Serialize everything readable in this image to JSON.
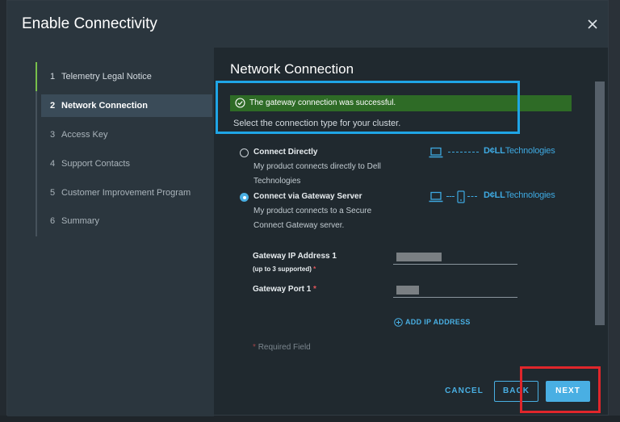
{
  "dialog": {
    "title": "Enable Connectivity"
  },
  "steps": [
    {
      "num": "1",
      "label": "Telemetry Legal Notice",
      "state": "complete"
    },
    {
      "num": "2",
      "label": "Network Connection",
      "state": "current"
    },
    {
      "num": "3",
      "label": "Access Key",
      "state": "pending"
    },
    {
      "num": "4",
      "label": "Support Contacts",
      "state": "pending"
    },
    {
      "num": "5",
      "label": "Customer Improvement Program",
      "state": "pending"
    },
    {
      "num": "6",
      "label": "Summary",
      "state": "pending"
    }
  ],
  "content": {
    "section_title": "Network Connection",
    "success_message": "The gateway connection was successful.",
    "select_prompt": "Select the connection type for your cluster.",
    "options": [
      {
        "label": "Connect Directly",
        "description": "My product connects directly to Dell Technologies",
        "selected": false,
        "diagram_icon": "laptop-icon"
      },
      {
        "label": "Connect via Gateway Server",
        "description": "My product connects to a Secure Connect Gateway server.",
        "selected": true,
        "diagram_icon": "gateway-server-icon"
      }
    ],
    "brand_bold": "D¢LL",
    "brand_text": "Technologies",
    "fields": {
      "ip_label": "Gateway IP Address 1",
      "ip_sublabel": "(up to 3 supported)",
      "port_label": "Gateway Port 1",
      "required_mark": "*"
    },
    "add_ip_label": "ADD IP ADDRESS",
    "required_note": "Required Field"
  },
  "buttons": {
    "cancel": "CANCEL",
    "back": "BACK",
    "next": "NEXT"
  },
  "colors": {
    "accent": "#49afe3",
    "success": "#2e6b26",
    "step_complete": "#78c04b",
    "highlight_blue": "#1fa5e6",
    "highlight_red": "#e0262b"
  }
}
